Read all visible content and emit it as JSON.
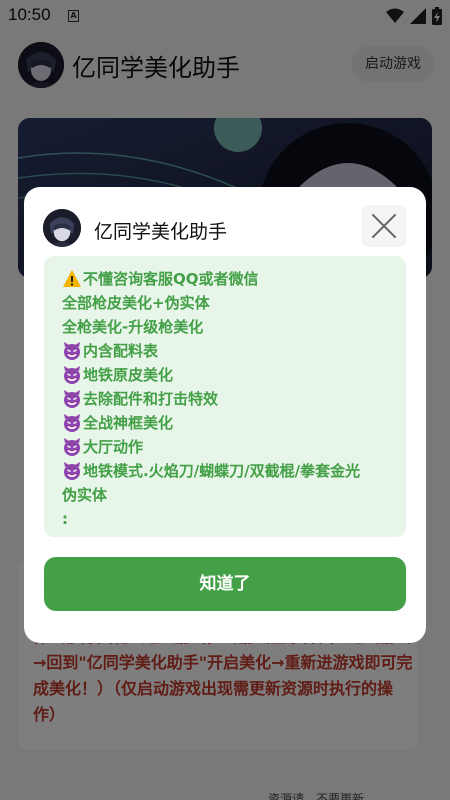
{
  "status_bar": {
    "time": "10:50",
    "notification_glyph": "A",
    "icons": [
      "wifi-icon",
      "signal-icon",
      "battery-charging-icon"
    ]
  },
  "header": {
    "app_title": "亿同学美化助手",
    "launch_button": "启动游戏"
  },
  "bottom_card": {
    "text": "作（移除美化→进入游戏，到游戏登录界面→退出游戏→回到\"亿同学美化助手\"开启美化→重新进游戏即可完成美化！）（仅启动游戏出现需更新资源时执行的操作）",
    "hint": "资源请…不要更新…"
  },
  "dialog": {
    "title": "亿同学美化助手",
    "close_icon": "close-icon",
    "lines": [
      {
        "icon": "warning-icon",
        "text": "不懂咨询客服QQ或者微信"
      },
      {
        "icon": "",
        "text": "全部枪皮美化+伪实体"
      },
      {
        "icon": "",
        "text": "全枪美化-升级枪美化"
      },
      {
        "icon": "devil-icon",
        "text": "内含配料表"
      },
      {
        "icon": "devil-icon",
        "text": "地铁原皮美化"
      },
      {
        "icon": "devil-icon",
        "text": "去除配件和打击特效"
      },
      {
        "icon": "devil-icon",
        "text": "全战神框美化"
      },
      {
        "icon": "devil-icon",
        "text": "大厅动作"
      },
      {
        "icon": "devil-icon",
        "text": "地铁模式.火焰刀/蝴蝶刀/双截棍/拳套金光"
      },
      {
        "icon": "",
        "text": "伪实体"
      },
      {
        "icon": "",
        "text": ":"
      }
    ],
    "ok_button": "知道了"
  },
  "colors": {
    "accent_green": "#43a047",
    "content_bg": "#e8f5e9",
    "warning_red": "#c0392b"
  }
}
